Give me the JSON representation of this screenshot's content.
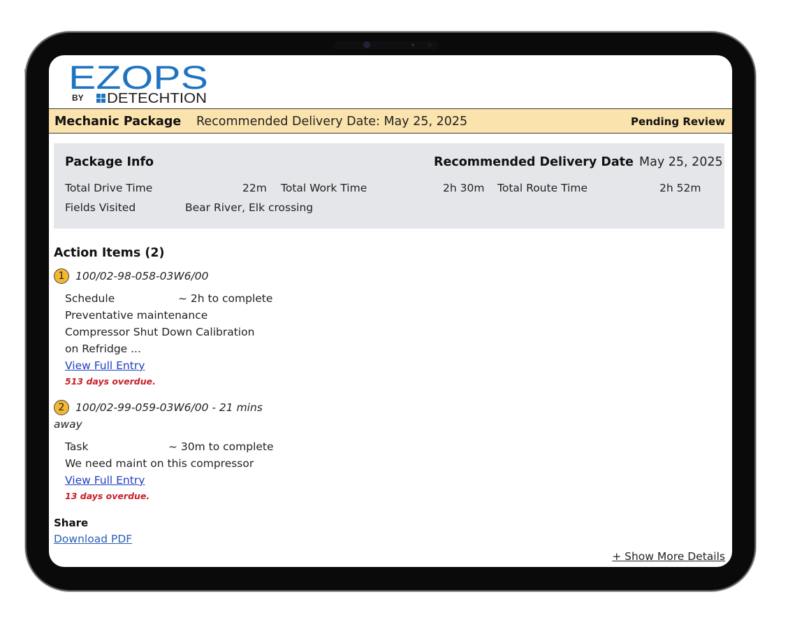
{
  "brand": {
    "logo_main": "EZOPS",
    "logo_by": "BY",
    "logo_sub": "DETECHTION",
    "color_blue": "#1f74c0",
    "color_dark": "#1d1d1d"
  },
  "banner": {
    "title": "Mechanic Package",
    "delivery_text": "Recommended Delivery Date: May 25, 2025",
    "status": "Pending Review",
    "background": "#fbe3ad"
  },
  "package_info": {
    "heading": "Package Info",
    "rdd_label": "Recommended Delivery Date",
    "rdd_value": "May 25, 2025",
    "drive_time_label": "Total Drive Time",
    "drive_time_value": "22m",
    "work_time_label": "Total Work Time",
    "work_time_value": "2h 30m",
    "route_time_label": "Total Route Time",
    "route_time_value": "2h 52m",
    "fields_label": "Fields Visited",
    "fields_value": "Bear River, Elk crossing"
  },
  "action_items": {
    "heading": "Action Items (2)",
    "items": [
      {
        "number": "1",
        "id": "100/02-98-058-03W6/00",
        "id_cont": "",
        "type": "Schedule",
        "duration": "~ 2h to complete",
        "desc_lines": [
          "Preventative maintenance",
          "Compressor Shut Down Calibration",
          "on Refridge ..."
        ],
        "link": "View Full Entry",
        "overdue": "513 days overdue."
      },
      {
        "number": "2",
        "id": "100/02-99-059-03W6/00 - 21 mins",
        "id_cont": "away",
        "type": "Task",
        "duration": "~ 30m to complete",
        "desc_lines": [
          "We need maint on this compressor"
        ],
        "link": "View Full Entry",
        "overdue": "13 days overdue."
      }
    ]
  },
  "share": {
    "heading": "Share",
    "download_link": "Download PDF"
  },
  "show_more": "+ Show More Details"
}
